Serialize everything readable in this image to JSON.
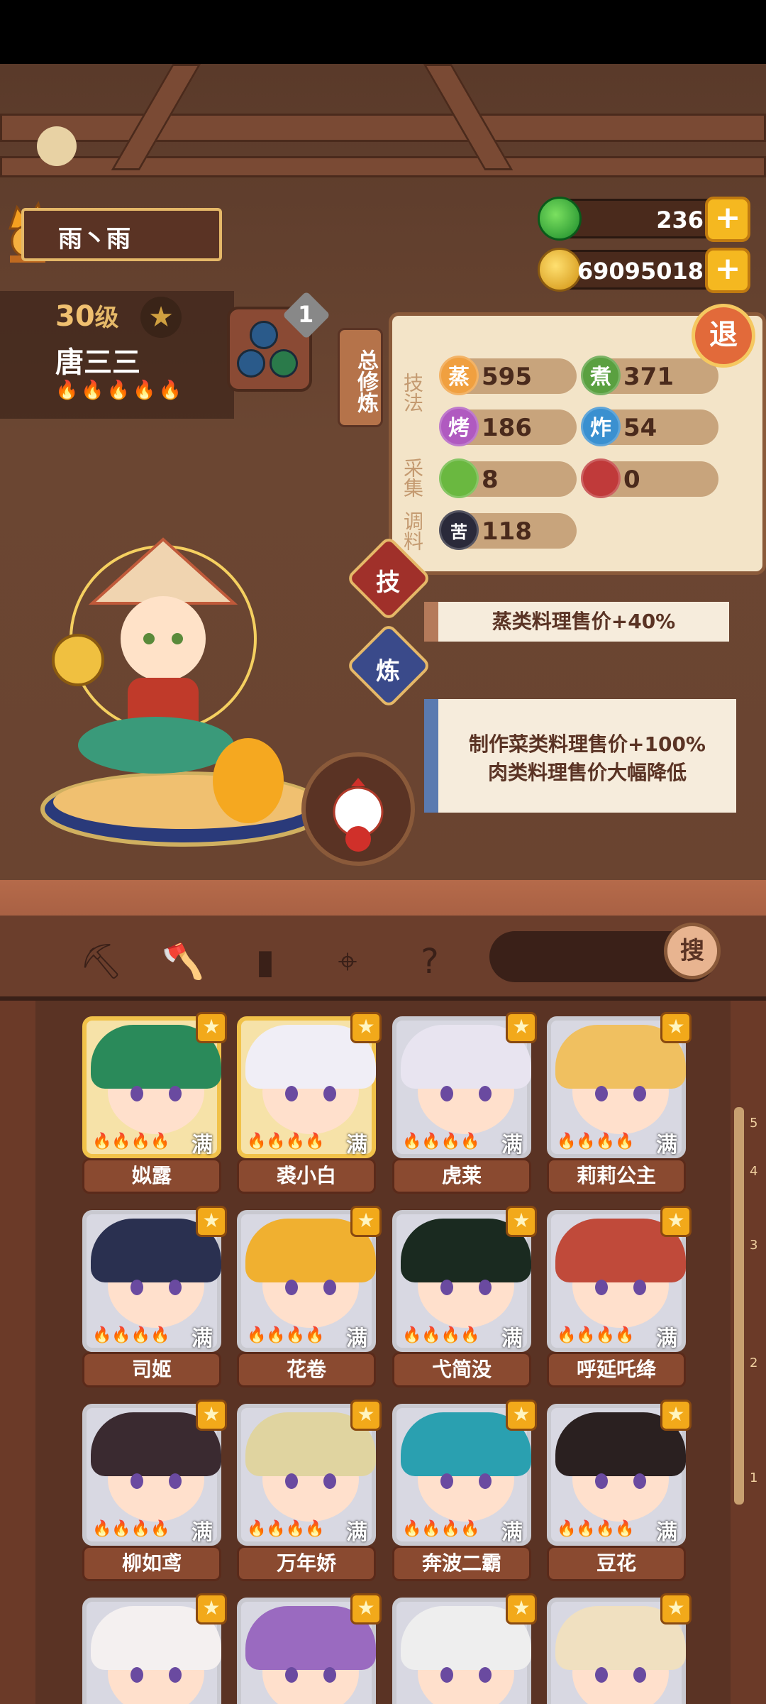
{
  "player": {
    "name": "雨丶雨"
  },
  "currency": {
    "jade": "236",
    "coins": "69095018"
  },
  "character": {
    "level_num": "30",
    "level_unit": "级",
    "name": "唐三三",
    "flames": "🔥🔥🔥🔥🔥",
    "skill_badge": "1"
  },
  "stats_panel": {
    "tab_label": "总修炼",
    "labels": {
      "technique": "技法",
      "gather": "采集",
      "season": "调料"
    },
    "exit": "退",
    "items": [
      {
        "badge": "蒸",
        "value": "595",
        "color": "#f0a040"
      },
      {
        "badge": "煮",
        "value": "371",
        "color": "#5aa040"
      },
      {
        "badge": "烤",
        "value": "186",
        "color": "#b05ac0"
      },
      {
        "badge": "炸",
        "value": "54",
        "color": "#3a90d0"
      },
      {
        "badge": "",
        "value": "8",
        "color": "#6ab840"
      },
      {
        "badge": "",
        "value": "0",
        "color": "#c03a3a"
      },
      {
        "badge": "苦",
        "value": "118",
        "color": "#2a2a3a"
      }
    ]
  },
  "skills": {
    "ji": {
      "badge": "技",
      "text": "蒸类料理售价+40%"
    },
    "lian": {
      "badge": "炼",
      "line1": "制作菜类料理售价+100%",
      "line2": "肉类料理售价大幅降低"
    }
  },
  "search": {
    "button": "搜"
  },
  "max_label": "满",
  "cards": [
    {
      "name": "姒露",
      "gold": true,
      "hair": "#2a8a5a"
    },
    {
      "name": "裘小白",
      "gold": true,
      "hair": "#f0eef6"
    },
    {
      "name": "虎莱",
      "gold": false,
      "hair": "#e8e4f0"
    },
    {
      "name": "莉莉公主",
      "gold": false,
      "hair": "#f0c060"
    },
    {
      "name": "司姬",
      "gold": false,
      "hair": "#2a3050"
    },
    {
      "name": "花卷",
      "gold": false,
      "hair": "#f0b030"
    },
    {
      "name": "弋简没",
      "gold": false,
      "hair": "#1a2a20"
    },
    {
      "name": "呼延吒绛",
      "gold": false,
      "hair": "#c04a3a"
    },
    {
      "name": "柳如鸢",
      "gold": false,
      "hair": "#3a2a30"
    },
    {
      "name": "万年娇",
      "gold": false,
      "hair": "#e0d4a0"
    },
    {
      "name": "奔波二霸",
      "gold": false,
      "hair": "#2aa0b0"
    },
    {
      "name": "豆花",
      "gold": false,
      "hair": "#2a2020"
    },
    {
      "name": "",
      "gold": false,
      "hair": "#f4f0f0"
    },
    {
      "name": "",
      "gold": false,
      "hair": "#9a6ac0"
    },
    {
      "name": "",
      "gold": false,
      "hair": "#eeeeee"
    },
    {
      "name": "",
      "gold": false,
      "hair": "#f0e0c0"
    }
  ],
  "scale_ticks": [
    "5",
    "4",
    "3",
    "2",
    "1"
  ]
}
